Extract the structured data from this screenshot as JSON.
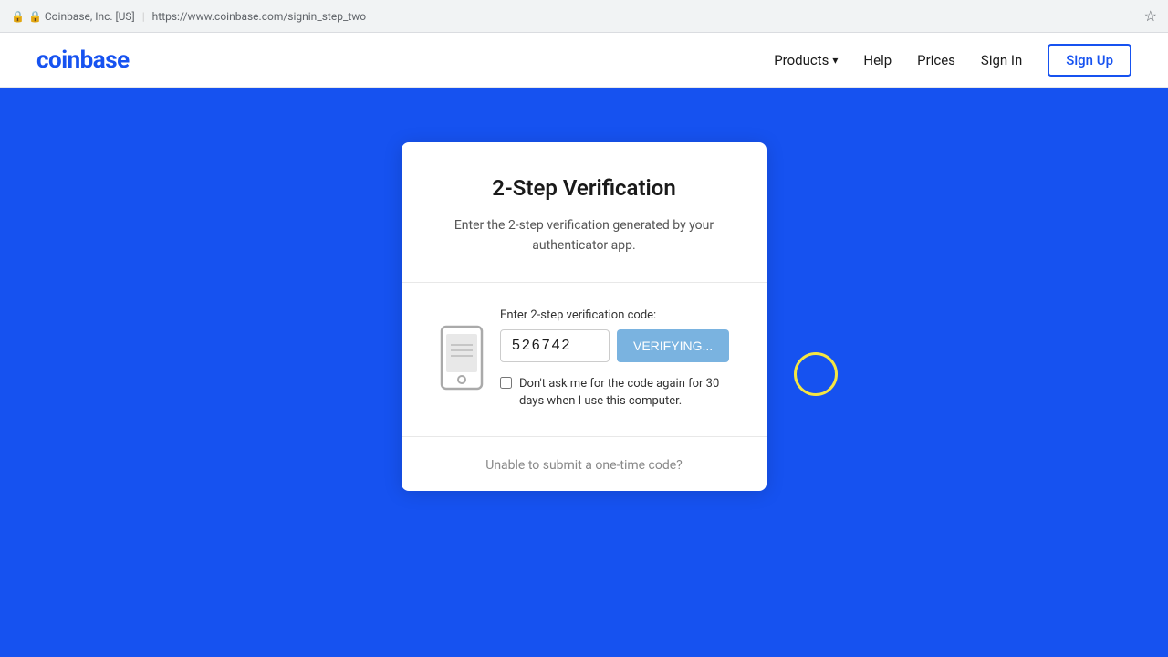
{
  "browser": {
    "lock_text": "🔒 Coinbase, Inc. [US]",
    "url": "https://www.coinbase.com/signin_step_two",
    "star_icon": "☆"
  },
  "navbar": {
    "logo": "coinbase",
    "products_label": "Products",
    "help_label": "Help",
    "prices_label": "Prices",
    "signin_label": "Sign In",
    "signup_label": "Sign Up"
  },
  "card": {
    "title": "2-Step Verification",
    "description": "Enter the 2-step verification generated by your authenticator app.",
    "form": {
      "label": "Enter 2-step verification code:",
      "code_value": "526742",
      "verifying_label": "VERIFYING...",
      "checkbox_label": "Don't ask me for the code again for 30 days when I use this computer."
    },
    "footer": {
      "link_text": "Unable to submit a one-time code?"
    }
  }
}
